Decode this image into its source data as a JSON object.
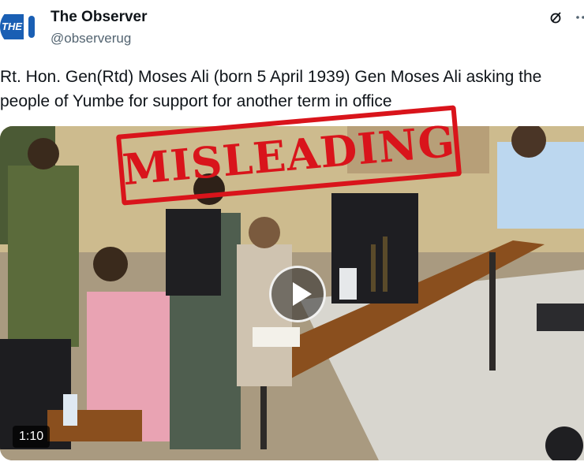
{
  "account": {
    "display_name": "The Observer",
    "handle": "@observerug",
    "avatar_text": "THE"
  },
  "tweet": {
    "text_line1": "Rt. Hon. Gen(Rtd) Moses Ali (born 5 April 1939) Gen Moses Ali asking the",
    "text_line2": "people of Yumbe for support for another term in office"
  },
  "media": {
    "overlay_stamp": "MISLEADING",
    "duration": "1:10",
    "stamp_color": "#d9141b"
  },
  "icons": {
    "grok": "grok-icon",
    "more": "more-icon",
    "play": "play-icon"
  }
}
